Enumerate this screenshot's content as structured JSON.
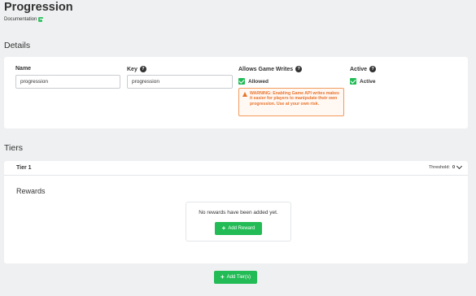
{
  "page": {
    "title": "Progression",
    "documentation_label": "Documentation"
  },
  "details": {
    "section_title": "Details",
    "name": {
      "label": "Name",
      "value": "progression"
    },
    "key": {
      "label": "Key",
      "value": "progression"
    },
    "allows_game_writes": {
      "label": "Allows Game Writes",
      "checkbox_label": "Allowed",
      "checked": true,
      "warning": "WARNING: Enabling Game API writes makes it easier for players to manipulate their own progression. Use at your own risk."
    },
    "active": {
      "label": "Active",
      "checkbox_label": "Active",
      "checked": true
    }
  },
  "tiers": {
    "section_title": "Tiers",
    "items": [
      {
        "name": "Tier 1",
        "threshold_label": "Threshold:",
        "threshold_value": "0",
        "rewards_title": "Rewards",
        "empty_text": "No rewards have been added yet.",
        "add_reward_label": "Add Reward"
      }
    ],
    "add_tier_label": "Add Tier(s)"
  },
  "colors": {
    "accent_green": "#22bb55",
    "warning_orange": "#e8742c",
    "background": "#eff0f1"
  },
  "icons": {
    "help": "question-circle-icon",
    "warning": "warning-triangle-icon",
    "external_link": "external-link-icon",
    "checkbox": "checkmark-icon",
    "chevron": "chevron-down-icon",
    "plus": "plus-icon"
  }
}
